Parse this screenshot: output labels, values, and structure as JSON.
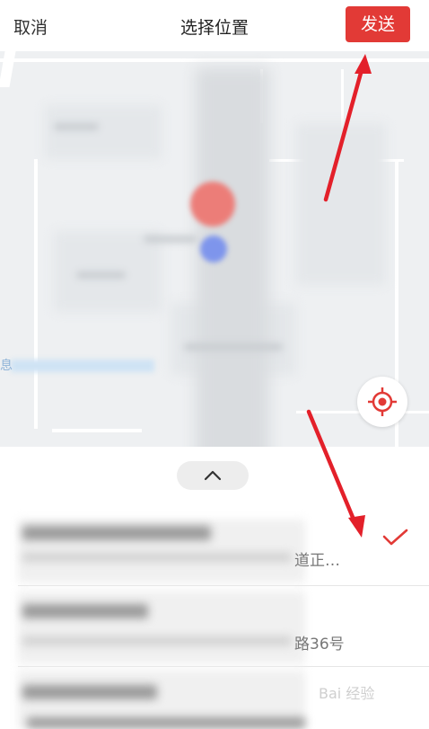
{
  "header": {
    "cancel_label": "取消",
    "title": "选择位置",
    "send_label": "发送"
  },
  "map": {
    "edge_text": "息"
  },
  "locations": [
    {
      "address_tail": "道正…",
      "selected": true
    },
    {
      "address_tail": "路36号",
      "selected": false
    },
    {
      "address_tail": "",
      "selected": false
    }
  ],
  "watermark": "Bai 经验",
  "colors": {
    "accent": "#e23a36",
    "annotation_arrow": "#e3202a"
  }
}
